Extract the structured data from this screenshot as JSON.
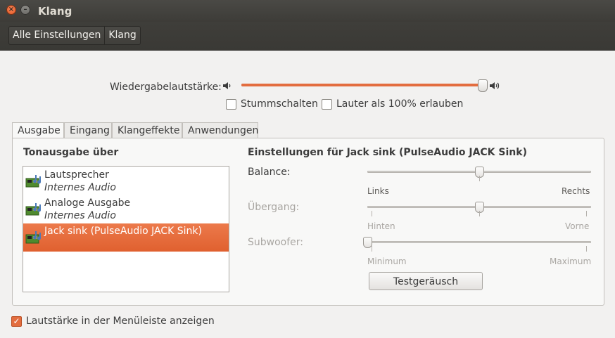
{
  "window": {
    "title": "Klang"
  },
  "breadcrumbs": [
    "Alle Einstellungen",
    "Klang"
  ],
  "volume": {
    "label": "Wiedergabelautstärke:",
    "level": 0.99,
    "mute_label": "Stummschalten",
    "mute_checked": false,
    "overamp_label": "Lauter als 100% erlauben",
    "overamp_checked": false
  },
  "tabs": [
    "Ausgabe",
    "Eingang",
    "Klangeffekte",
    "Anwendungen"
  ],
  "output": {
    "heading": "Tonausgabe über",
    "devices": [
      {
        "name": "Lautsprecher",
        "sub": "Internes Audio",
        "selected": false
      },
      {
        "name": "Analoge Ausgabe",
        "sub": "Internes Audio",
        "selected": false
      },
      {
        "name": "Jack sink (PulseAudio JACK Sink)",
        "sub": "",
        "selected": true
      }
    ]
  },
  "settings": {
    "heading": "Einstellungen für Jack sink (PulseAudio JACK Sink)",
    "balance": {
      "label": "Balance:",
      "left": "Links",
      "right": "Rechts",
      "value": 0.5
    },
    "fade": {
      "label": "Übergang:",
      "left": "Hinten",
      "right": "Vorne",
      "value": 0.5
    },
    "subwoofer": {
      "label": "Subwoofer:",
      "left": "Minimum",
      "right": "Maximum",
      "value": 0.0
    },
    "test_button": "Testgeräusch"
  },
  "show_in_menubar": {
    "label": "Lautstärke in der Menüleiste anzeigen",
    "checked": true
  },
  "colors": {
    "accent": "#e36d3f",
    "titlebar": "#3d3c38"
  }
}
